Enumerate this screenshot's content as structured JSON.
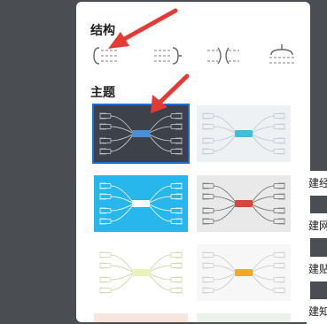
{
  "panel": {
    "structure_title": "结构",
    "theme_title": "主题",
    "structures": [
      {
        "name": "left-tree-structure"
      },
      {
        "name": "right-tree-structure"
      },
      {
        "name": "balanced-structure"
      },
      {
        "name": "org-chart-structure"
      }
    ],
    "themes": [
      {
        "name": "dark-theme",
        "bg": "#3d4149",
        "center": "#4a90d9",
        "line": "#cfd6df",
        "selected": true
      },
      {
        "name": "light-blue-theme",
        "bg": "#eef1f4",
        "center": "#3cc0d8",
        "line": "#bcc6cf",
        "selected": false
      },
      {
        "name": "cyan-theme",
        "bg": "#27b7ec",
        "center": "#ffffff",
        "line": "#ffffff",
        "selected": false
      },
      {
        "name": "red-center-theme",
        "bg": "#e9e9e9",
        "center": "#d9443b",
        "line": "#6b6b6b",
        "selected": false
      },
      {
        "name": "green-theme",
        "bg": "#ffffff",
        "center": "#e7f4b8",
        "line": "#c5d3a0",
        "selected": false
      },
      {
        "name": "orange-theme",
        "bg": "#f7f7f7",
        "center": "#f5a623",
        "line": "#c9c9c9",
        "selected": false
      }
    ]
  },
  "side_items": [
    "建经",
    "建网",
    "建贴",
    "建知"
  ],
  "colors": {
    "arrow": "#e53935",
    "selection": "#1e6bd8"
  }
}
